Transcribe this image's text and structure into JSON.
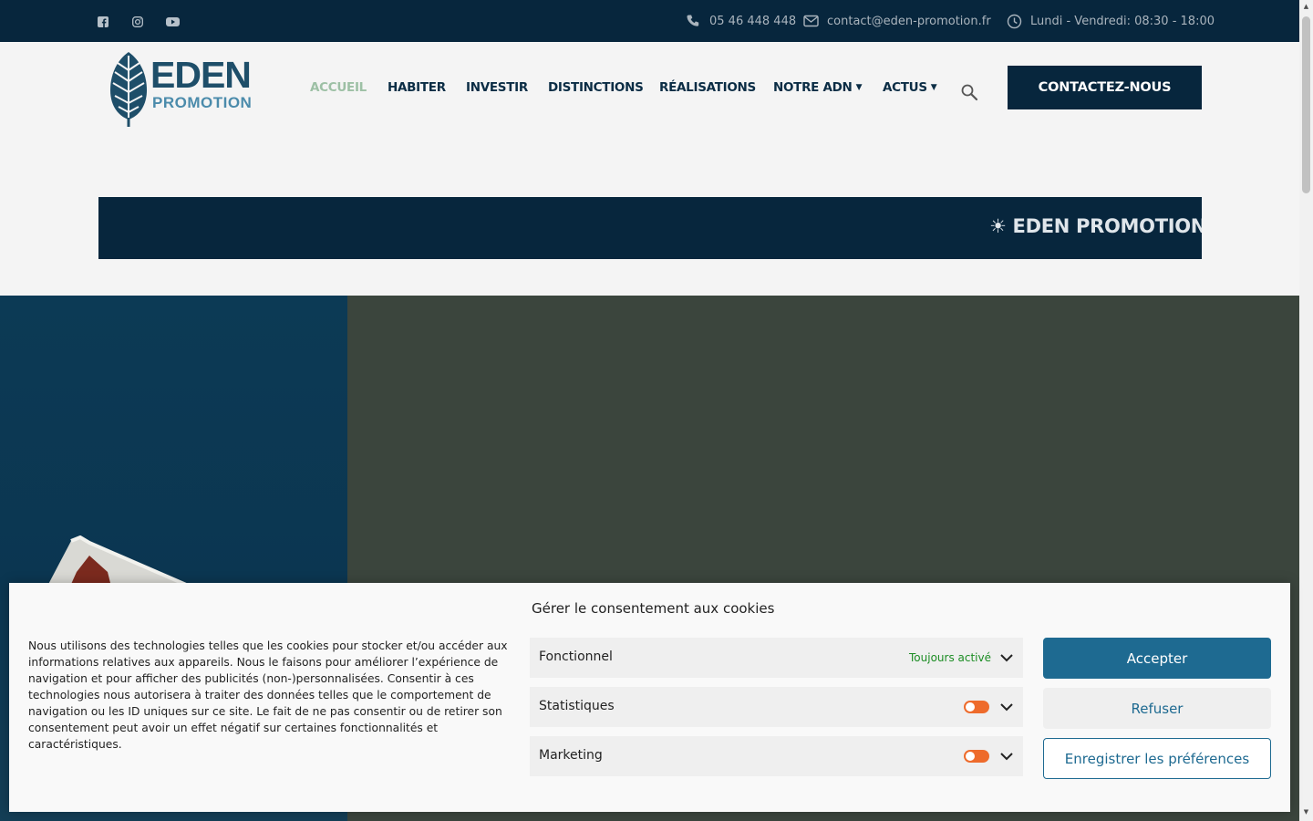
{
  "topbar": {
    "social": [
      "facebook-icon",
      "instagram-icon",
      "youtube-icon"
    ],
    "phone": "05 46 448 448",
    "email": "contact@eden-promotion.fr",
    "hours": "Lundi - Vendredi: 08:30 - 18:00"
  },
  "logo": {
    "top": "EDEN",
    "bottom": "PROMOTION"
  },
  "nav": {
    "items": [
      {
        "label": "ACCUEIL",
        "active": true
      },
      {
        "label": "HABITER"
      },
      {
        "label": "INVESTIR"
      },
      {
        "label": "DISTINCTIONS"
      },
      {
        "label": "RÉALISATIONS"
      },
      {
        "label": "NOTRE ADN",
        "dropdown": true
      },
      {
        "label": "ACTUS",
        "dropdown": true
      }
    ],
    "cta": "CONTACTEZ-NOUS"
  },
  "ticker": {
    "text": "☀ EDEN PROMOTION R"
  },
  "cookie": {
    "title": "Gérer le consentement aux cookies",
    "description": "Nous utilisons des technologies telles que les cookies pour stocker et/ou accéder aux informations relatives aux appareils. Nous le faisons pour améliorer l’expérience de navigation et pour afficher des publicités (non-)personnalisées. Consentir à ces technologies nous autorisera à traiter des données telles que le comportement de navigation ou les ID uniques sur ce site. Le fait de ne pas consentir ou de retirer son consentement peut avoir un effet négatif sur certaines fonctionnalités et caractéristiques.",
    "categories": [
      {
        "label": "Fonctionnel",
        "status": "Toujours activé"
      },
      {
        "label": "Statistiques"
      },
      {
        "label": "Marketing"
      }
    ],
    "accept": "Accepter",
    "deny": "Refuser",
    "save": "Enregistrer les préférences"
  },
  "colors": {
    "navy": "#07263d",
    "accent": "#1e6a91",
    "toggle": "#ee6b2b",
    "active_nav": "#9dc0a5",
    "always_on": "#1c8d24"
  }
}
